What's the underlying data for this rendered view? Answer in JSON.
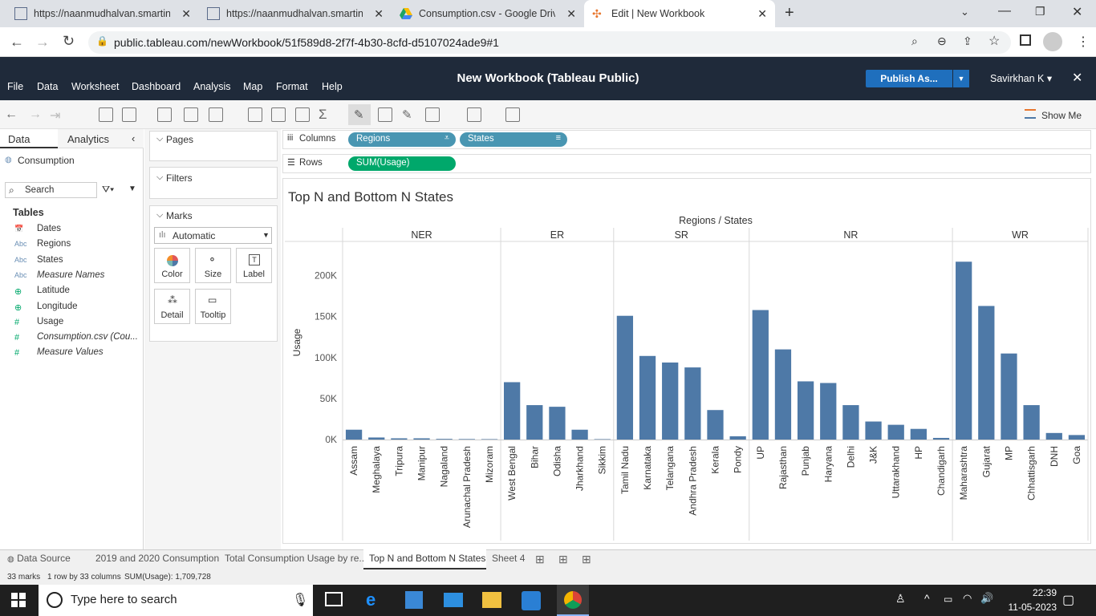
{
  "browser": {
    "tabs": [
      {
        "title": "https://naanmudhalvan.smartinte"
      },
      {
        "title": "https://naanmudhalvan.smartinte"
      },
      {
        "title": "Consumption.csv - Google Drive"
      },
      {
        "title": "Edit | New Workbook"
      }
    ],
    "url": "public.tableau.com/newWorkbook/51f589d8-2f7f-4b30-8cfd-d5107024ade9#1"
  },
  "tableau": {
    "title": "New Workbook (Tableau Public)",
    "menu": [
      "File",
      "Data",
      "Worksheet",
      "Dashboard",
      "Analysis",
      "Map",
      "Format",
      "Help"
    ],
    "publish_label": "Publish As...",
    "user": "Savirkhan K ▾",
    "show_me": "Show Me"
  },
  "left": {
    "tab_data": "Data",
    "tab_analytics": "Analytics",
    "datasource": "Consumption",
    "search_placeholder": "Search",
    "tables_label": "Tables",
    "fields": [
      {
        "name": "Dates",
        "type": "date"
      },
      {
        "name": "Regions",
        "type": "Abc"
      },
      {
        "name": "States",
        "type": "Abc"
      },
      {
        "name": "Measure Names",
        "type": "Abc"
      },
      {
        "name": "Latitude",
        "type": "geo"
      },
      {
        "name": "Longitude",
        "type": "geo"
      },
      {
        "name": "Usage",
        "type": "#"
      },
      {
        "name": "Consumption.csv (Cou...",
        "type": "#"
      },
      {
        "name": "Measure Values",
        "type": "#"
      }
    ]
  },
  "cards": {
    "pages": "Pages",
    "filters": "Filters",
    "marks": "Marks",
    "mark_type": "Automatic",
    "buttons": [
      "Color",
      "Size",
      "Label",
      "Detail",
      "Tooltip"
    ]
  },
  "shelves": {
    "columns_label": "Columns",
    "rows_label": "Rows",
    "col_pills": [
      "Regions",
      "States"
    ],
    "row_pill": "SUM(Usage)"
  },
  "chart_data": {
    "type": "bar",
    "title": "Top N and Bottom N States",
    "header": "Regions / States",
    "ylabel": "Usage",
    "ylim": [
      0,
      230000
    ],
    "yticks": [
      "0K",
      "50K",
      "100K",
      "150K",
      "200K"
    ],
    "regions": [
      {
        "name": "NER",
        "states": [
          "Assam",
          "Meghalaya",
          "Tripura",
          "Manipur",
          "Nagaland",
          "Arunachal Pradesh",
          "Mizoram"
        ],
        "values": [
          12000,
          2500,
          1500,
          1500,
          800,
          600,
          500
        ]
      },
      {
        "name": "ER",
        "states": [
          "West Bengal",
          "Bihar",
          "Odisha",
          "Jharkhand",
          "Sikkim"
        ],
        "values": [
          70000,
          42000,
          40000,
          12000,
          500
        ]
      },
      {
        "name": "SR",
        "states": [
          "Tamil Nadu",
          "Karnataka",
          "Telangana",
          "Andhra Pradesh",
          "Kerala",
          "Pondy"
        ],
        "values": [
          151000,
          102000,
          94000,
          88000,
          36000,
          4000
        ]
      },
      {
        "name": "NR",
        "states": [
          "UP",
          "Rajasthan",
          "Punjab",
          "Haryana",
          "Delhi",
          "J&K",
          "Uttarakhand",
          "HP",
          "Chandigarh"
        ],
        "values": [
          158000,
          110000,
          71000,
          69000,
          42000,
          22000,
          18000,
          13000,
          2000
        ]
      },
      {
        "name": "WR",
        "states": [
          "Maharashtra",
          "Gujarat",
          "MP",
          "Chhattisgarh",
          "DNH",
          "Goa"
        ],
        "values": [
          217000,
          163000,
          105000,
          42000,
          8000,
          5500
        ]
      }
    ],
    "bar_color": "#4e79a7"
  },
  "sheets": [
    "Data Source",
    "2019 and 2020 Consumption",
    "Total Consumption Usage by re...",
    "Top N and Bottom N States",
    "Sheet 4"
  ],
  "status": {
    "marks": "33 marks",
    "dims": "1 row by 33 columns",
    "sum": "SUM(Usage): 1,709,728"
  },
  "taskbar": {
    "search_placeholder": "Type here to search",
    "time": "22:39",
    "date": "11-05-2023"
  }
}
